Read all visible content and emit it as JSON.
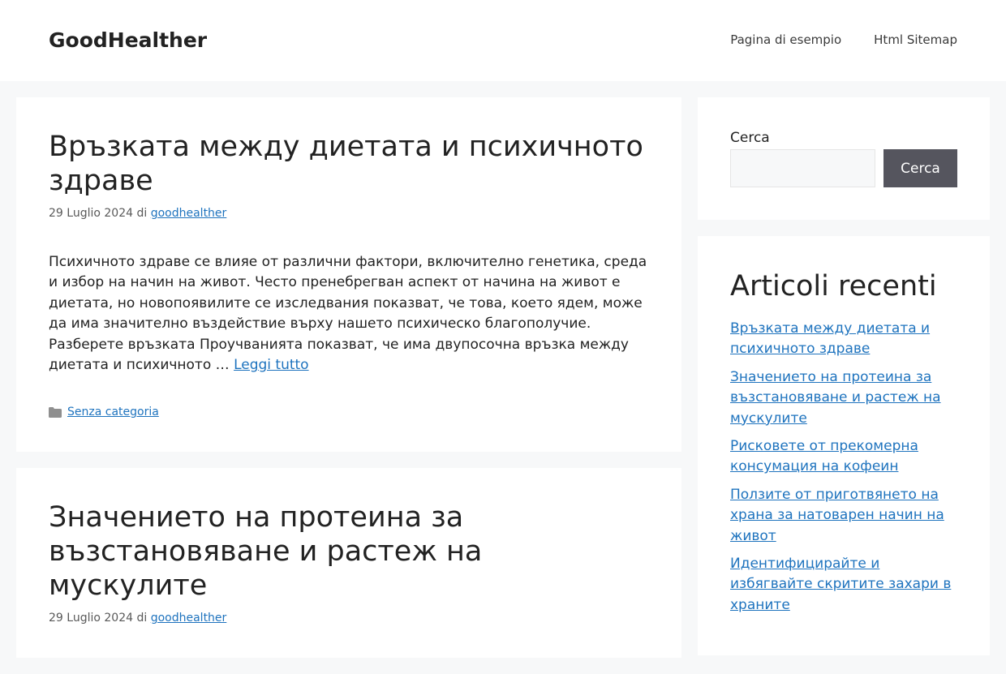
{
  "header": {
    "site_title": "GoodHealther",
    "nav": [
      {
        "label": "Pagina di esempio"
      },
      {
        "label": "Html Sitemap"
      }
    ]
  },
  "posts": [
    {
      "title": "Връзката между диетата и психичното здраве",
      "date": "29 Luglio 2024",
      "by": "di",
      "author": "goodhealther",
      "excerpt": "Психичното здраве се влияе от различни фактори, включително генетика, среда и избор на начин на живот. Често пренебрегван аспект от начина на живот е диетата, но новопоявилите се изследвания показват, че това, което ядем, може да има значително въздействие върху нашето психическо благополучие. Разберете връзката Проучванията показват, че има двупосочна връзка между диетата и психичното …",
      "read_more": "Leggi tutto",
      "category": "Senza categoria"
    },
    {
      "title": "Значението на протеина за възстановяване и растеж на мускулите",
      "date": "29 Luglio 2024",
      "by": "di",
      "author": "goodhealther"
    }
  ],
  "sidebar": {
    "search": {
      "label": "Cerca",
      "placeholder": "",
      "button_label": "Cerca"
    },
    "recent": {
      "title": "Articoli recenti",
      "items": [
        {
          "label": "Връзката между диетата и психичното здраве"
        },
        {
          "label": "Значението на протеина за възстановяване и растеж на мускулите"
        },
        {
          "label": "Рисковете от прекомерна консумация на кофеин"
        },
        {
          "label": "Ползите от приготвянето на храна за натоварен начин на живот"
        },
        {
          "label": "Идентифицирайте и избягвайте скритите захари в храните"
        }
      ]
    }
  },
  "icons": {
    "category": "folder-icon"
  },
  "colors": {
    "link": "#1e73be",
    "button_bg": "#55555e",
    "page_bg": "#f7f8f9"
  }
}
